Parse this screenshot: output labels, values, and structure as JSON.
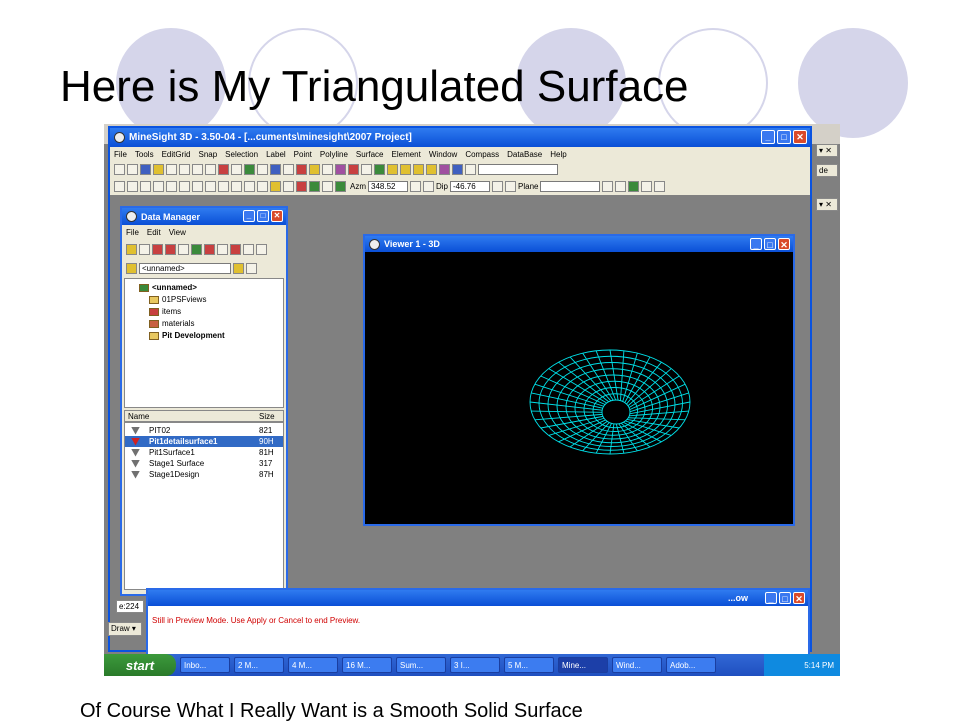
{
  "slide": {
    "title": "Here is My Triangulated Surface",
    "caption": "Of Course What I Really Want is a Smooth Solid Surface"
  },
  "app": {
    "title": "MineSight 3D  - 3.50-04 - [...cuments\\minesight\\2007 Project]",
    "menu": [
      "File",
      "Tools",
      "EditGrid",
      "Snap",
      "Selection",
      "Label",
      "Point",
      "Polyline",
      "Surface",
      "Element",
      "Window",
      "Compass",
      "DataBase",
      "Help"
    ],
    "toolbar2": {
      "azm_label": "Azm",
      "azm_value": "348.52",
      "dip_label": "Dip",
      "dip_value": "-46.76",
      "plane_label": "Plane"
    }
  },
  "data_manager": {
    "title": "Data Manager",
    "menu": [
      "File",
      "Edit",
      "View"
    ],
    "path_value": "<unnamed>",
    "tree": [
      {
        "label": "<unnamed>",
        "bold": true
      },
      {
        "label": "01PSFviews",
        "bold": false
      },
      {
        "label": "items",
        "bold": false
      },
      {
        "label": "materials",
        "bold": false
      },
      {
        "label": "Pit Development",
        "bold": true
      }
    ],
    "columns": {
      "name": "Name",
      "size": "Size"
    },
    "rows": [
      {
        "name": "PIT02",
        "size": "821"
      },
      {
        "name": "Pit1detailsurface1",
        "size": "90H"
      },
      {
        "name": "Pit1Surface1",
        "size": "81H"
      },
      {
        "name": "Stage1 Surface",
        "size": "317"
      },
      {
        "name": "Stage1Design",
        "size": "87H"
      }
    ],
    "selected_row": 1
  },
  "viewer": {
    "title": "Viewer 1 - 3D"
  },
  "message_window": {
    "title": "...ow",
    "message": "Still in Preview Mode. Use Apply or Cancel to end Preview.",
    "left_field": "e:224",
    "draw_label": "Draw ▾"
  },
  "taskbar": {
    "start_label": "start",
    "tasks": [
      "Inbo...",
      "2 M...",
      "4 M...",
      "16 M...",
      "Sum...",
      "3 I...",
      "5 M...",
      "Mine...",
      "Wind...",
      "Adob..."
    ],
    "active_task": 7,
    "clock": "5:14 PM"
  },
  "colors": {
    "surface_wireframe": "#00e0e8",
    "titlebar": "#0a4fd6",
    "message_text": "#d00000",
    "decor_circle": "#d5d5ea"
  }
}
